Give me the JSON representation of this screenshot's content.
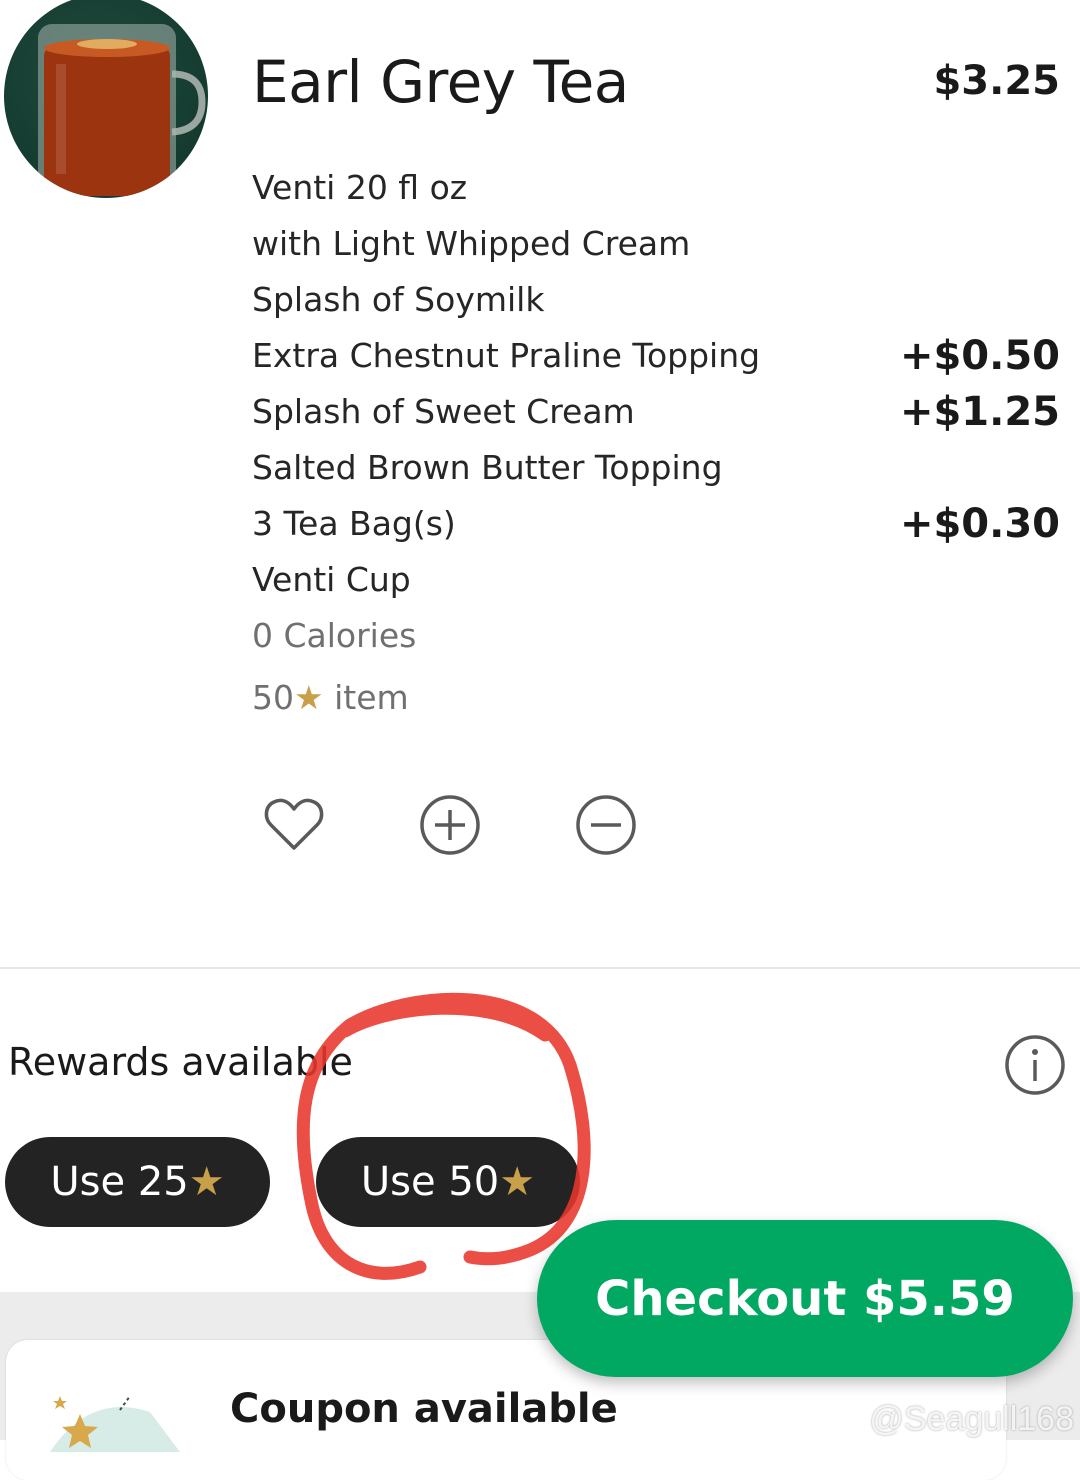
{
  "product": {
    "name": "Earl Grey Tea",
    "price": "$3.25",
    "image_icon": "tea-mug-icon"
  },
  "modifiers": [
    {
      "label": "Venti 20 fl oz",
      "price": ""
    },
    {
      "label": "with Light Whipped Cream",
      "price": ""
    },
    {
      "label": "Splash of Soymilk",
      "price": ""
    },
    {
      "label": "Extra Chestnut Praline Topping",
      "price": "+$0.50"
    },
    {
      "label": "Splash of Sweet Cream",
      "price": "+$1.25"
    },
    {
      "label": "Salted Brown Butter Topping",
      "price": ""
    },
    {
      "label": "3 Tea Bag(s)",
      "price": "+$0.30"
    },
    {
      "label": "Venti Cup",
      "price": ""
    }
  ],
  "calories": "0 Calories",
  "stars_item": {
    "value": "50",
    "star": "★",
    "suffix": " item"
  },
  "actions": {
    "favorite_icon": "heart-icon",
    "add_icon": "plus-circle-icon",
    "remove_icon": "minus-circle-icon"
  },
  "rewards": {
    "title": "Rewards available",
    "info_icon": "info-icon",
    "options": [
      {
        "label": "Use 25",
        "star": "★"
      },
      {
        "label": "Use 50",
        "star": "★"
      }
    ]
  },
  "coupon": {
    "title": "Coupon available",
    "icon": "coupon-star-icon"
  },
  "checkout": {
    "label": "Checkout $5.59"
  },
  "watermark": "@Seagull168",
  "colors": {
    "accent_green": "#00a862",
    "star_gold": "#c8a04a",
    "reward_button": "#232323",
    "annotation_red": "#e8362a"
  }
}
